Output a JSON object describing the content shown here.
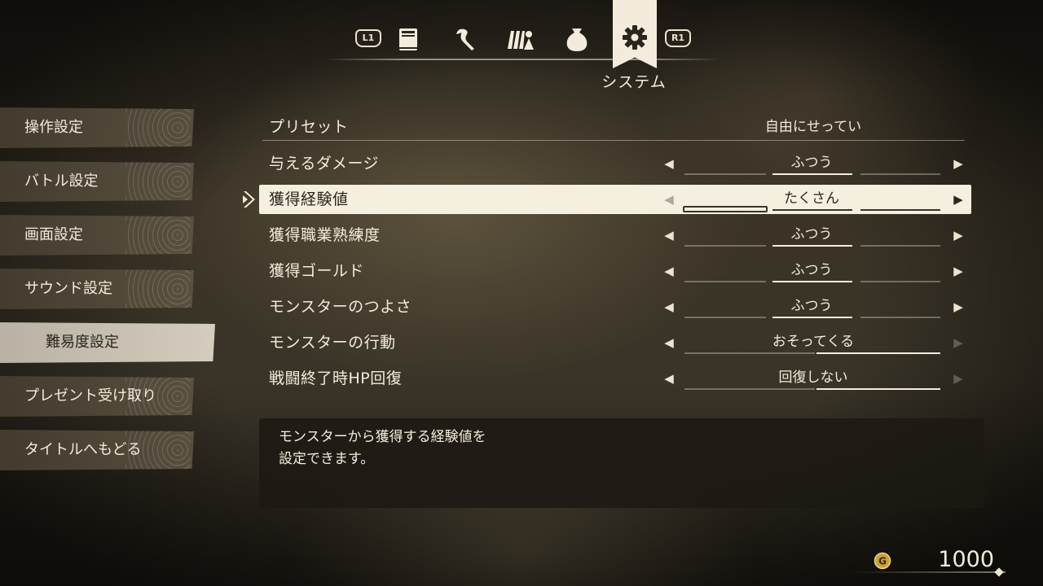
{
  "header": {
    "left_button": "L1",
    "right_button": "R1",
    "tabs": [
      {
        "icon": "book-icon"
      },
      {
        "icon": "skill-icon"
      },
      {
        "icon": "party-icon"
      },
      {
        "icon": "bag-icon"
      },
      {
        "icon": "gear-icon",
        "label": "システム",
        "active": true
      }
    ],
    "active_label": "システム"
  },
  "sidebar": {
    "items": [
      {
        "label": "操作設定"
      },
      {
        "label": "バトル設定"
      },
      {
        "label": "画面設定"
      },
      {
        "label": "サウンド設定"
      },
      {
        "label": "難易度設定",
        "active": true
      },
      {
        "label": "プレゼント受け取り"
      },
      {
        "label": "タイトルへもどる"
      }
    ]
  },
  "settings": {
    "preset": {
      "label": "プリセット",
      "value": "自由にせってい"
    },
    "rows": [
      {
        "label": "与えるダメージ",
        "value": "ふつう"
      },
      {
        "label": "獲得経験値",
        "value": "たくさん"
      },
      {
        "label": "獲得職業熟練度",
        "value": "ふつう"
      },
      {
        "label": "獲得ゴールド",
        "value": "ふつう"
      },
      {
        "label": "モンスターのつよさ",
        "value": "ふつう"
      },
      {
        "label": "モンスターの行動",
        "value": "おそってくる"
      },
      {
        "label": "戦闘終了時HP回復",
        "value": "回復しない"
      }
    ],
    "selected_index": 1
  },
  "description": {
    "text": "モンスターから獲得する経験値を\n設定できます。"
  },
  "gold": {
    "icon": "gold-coin-icon",
    "amount": "1000"
  },
  "colors": {
    "text": "#f3ecdd",
    "highlight": "#f5efe0",
    "panel": "#1c1812"
  }
}
